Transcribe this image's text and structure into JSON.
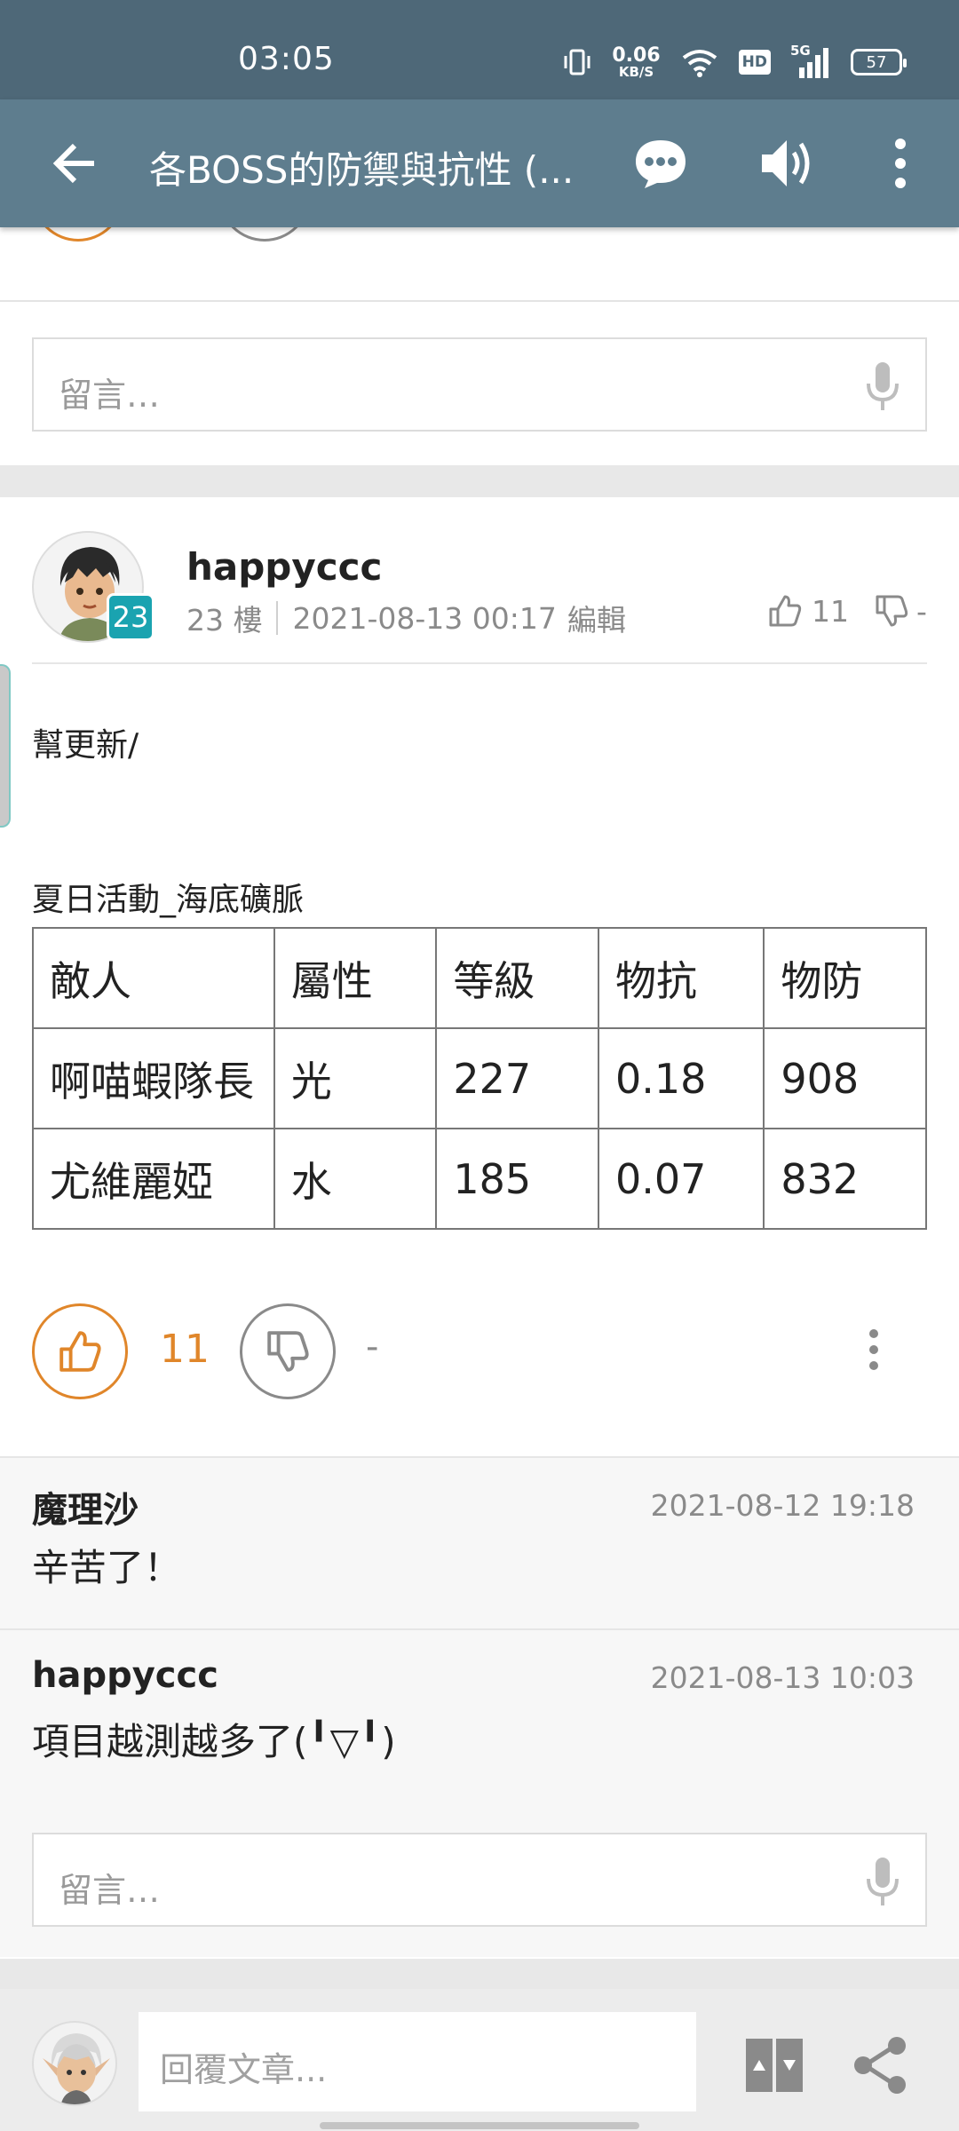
{
  "status_bar": {
    "time": "03:05",
    "speed_value": "0.06",
    "speed_unit": "KB/S",
    "hd": "HD",
    "network": "5G",
    "battery": "57"
  },
  "topbar": {
    "title": "各BOSS的防禦與抗性 (...",
    "icons": [
      "back-arrow-icon",
      "comment-bubble-icon",
      "speaker-icon",
      "more-vert-icon"
    ]
  },
  "comment_input_top": {
    "placeholder": "留言…"
  },
  "post": {
    "author": "happyccc",
    "level": "23",
    "floor": "23 樓",
    "date": "2021-08-13 00:17",
    "edit": "編輯",
    "likes": "11",
    "dislikes": "-",
    "body_line1": "幫更新/",
    "section_title": "夏日活動_海底礦脈",
    "table": {
      "headers": [
        "敵人",
        "屬性",
        "等級",
        "物抗",
        "物防"
      ],
      "rows": [
        [
          "啊喵蝦隊長",
          "光",
          "227",
          "0.18",
          "908"
        ],
        [
          "尤維麗婭",
          "水",
          "185",
          "0.07",
          "832"
        ]
      ]
    },
    "action_likes": "11",
    "action_dislikes": "-"
  },
  "replies": [
    {
      "name": "魔理沙",
      "date": "2021-08-12 19:18",
      "text": "辛苦了！"
    },
    {
      "name": "happyccc",
      "date": "2021-08-13 10:03",
      "text": "項目越測越多了(╹▽╹)"
    }
  ],
  "comment_input_bottom": {
    "placeholder": "留言…"
  },
  "bottom_bar": {
    "reply_placeholder": "回覆文章..."
  },
  "colors": {
    "status_bg": "#4e6878",
    "topbar_bg": "#5e7d8e",
    "accent": "#e0862a",
    "level_badge": "#1aa3b0"
  }
}
